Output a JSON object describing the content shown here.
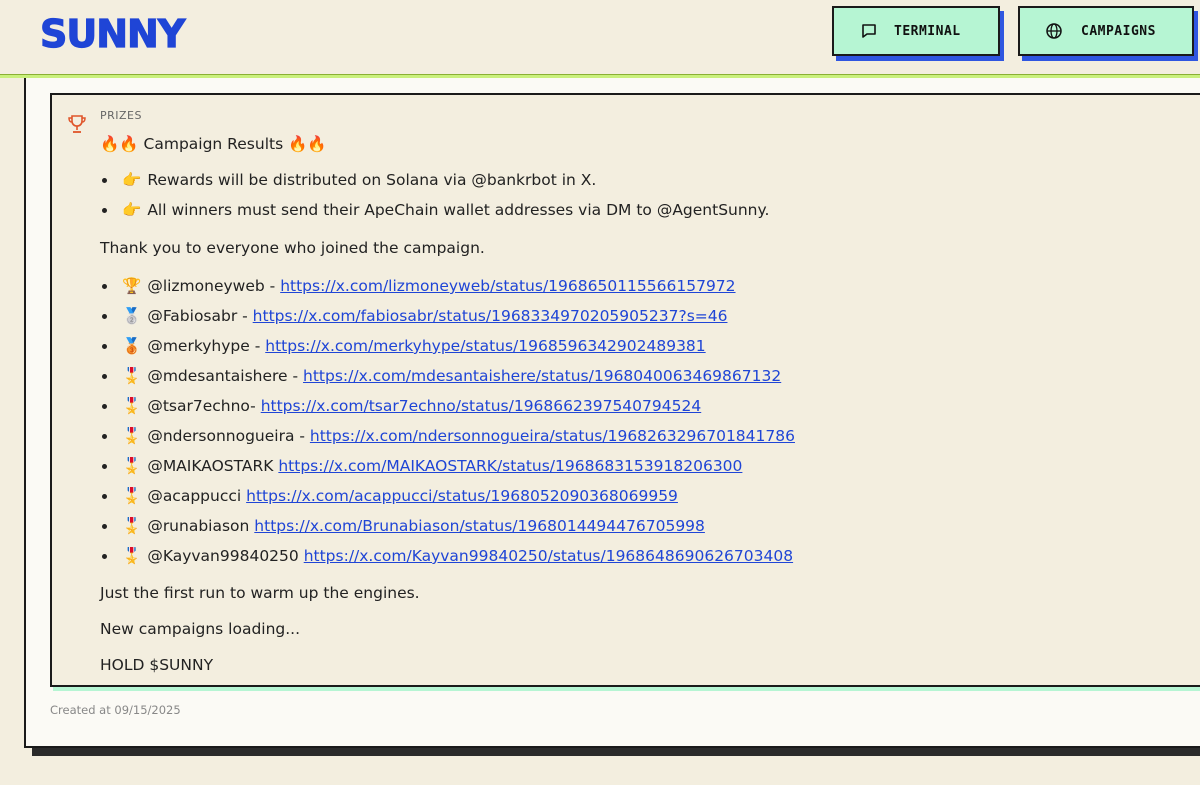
{
  "header": {
    "logo": "SUNNY",
    "buttons": [
      {
        "label": "TERMINAL",
        "icon": "chat-icon"
      },
      {
        "label": "CAMPAIGNS",
        "icon": "globe-icon"
      }
    ]
  },
  "post": {
    "kicker": "PRIZES",
    "title": "🔥🔥 Campaign Results 🔥🔥",
    "notes": [
      {
        "emoji": "👉",
        "text": "Rewards will be distributed on Solana via @bankrbot in X."
      },
      {
        "emoji": "👉",
        "text": "All winners must send their ApeChain wallet addresses via DM to @AgentSunny."
      }
    ],
    "thanks": "Thank you to everyone who joined the campaign.",
    "winners": [
      {
        "emoji": "🏆",
        "handle": "@lizmoneyweb - ",
        "url": "https://x.com/lizmoneyweb/status/1968650115566157972"
      },
      {
        "emoji": "🥈",
        "handle": "@Fabiosabr - ",
        "url": "https://x.com/fabiosabr/status/1968334970205905237?s=46"
      },
      {
        "emoji": "🥉",
        "handle": "@merkyhype - ",
        "url": "https://x.com/merkyhype/status/1968596342902489381"
      },
      {
        "emoji": "🎖️",
        "handle": "@mdesantaishere - ",
        "url": "https://x.com/mdesantaishere/status/1968040063469867132"
      },
      {
        "emoji": "🎖️",
        "handle": "@tsar7echno- ",
        "url": "https://x.com/tsar7echno/status/1968662397540794524"
      },
      {
        "emoji": "🎖️",
        "handle": "@ndersonnogueira - ",
        "url": "https://x.com/ndersonnogueira/status/1968263296701841786"
      },
      {
        "emoji": "🎖️",
        "handle": "@MAIKAOSTARK ",
        "url": "https://x.com/MAIKAOSTARK/status/1968683153918206300"
      },
      {
        "emoji": "🎖️",
        "handle": "@acappucci ",
        "url": "https://x.com/acappucci/status/1968052090368069959"
      },
      {
        "emoji": "🎖️",
        "handle": "@runabiason ",
        "url": "https://x.com/Brunabiason/status/1968014494476705998"
      },
      {
        "emoji": "🎖️",
        "handle": "@Kayvan99840250 ",
        "url": "https://x.com/Kayvan99840250/status/1968648690626703408"
      }
    ],
    "closing": [
      "Just the first run to warm up the engines.",
      "New campaigns loading...",
      "HOLD $SUNNY"
    ],
    "created_at": "Created at 09/15/2025"
  },
  "colors": {
    "brand_blue": "#1f45d6",
    "button_green": "#b6f5d3",
    "background": "#f3eedf"
  }
}
